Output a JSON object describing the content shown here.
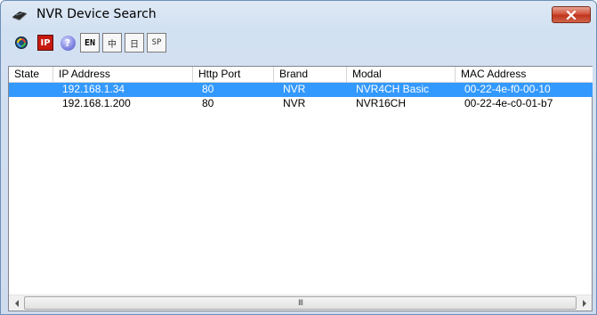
{
  "window": {
    "title": "NVR Device Search",
    "close_icon": "close-icon"
  },
  "toolbar": {
    "buttons": [
      {
        "name": "search-icon",
        "label": ""
      },
      {
        "name": "ip-icon",
        "label": "IP"
      },
      {
        "name": "help-icon",
        "label": "?"
      },
      {
        "name": "lang-en-button",
        "label": "EN"
      },
      {
        "name": "lang-zh-traditional-button",
        "label": "中"
      },
      {
        "name": "lang-zh-simplified-button",
        "label": "日"
      },
      {
        "name": "lang-sp-button",
        "label": "SP"
      }
    ]
  },
  "table": {
    "columns": [
      "State",
      "IP Address",
      "Http Port",
      "Brand",
      "Modal",
      "MAC Address"
    ],
    "rows": [
      {
        "state": "",
        "ip": "192.168.1.34",
        "port": "80",
        "brand": "NVR",
        "modal": "NVR4CH Basic",
        "mac": "00-22-4e-f0-00-10",
        "selected": true
      },
      {
        "state": "",
        "ip": "192.168.1.200",
        "port": "80",
        "brand": "NVR",
        "modal": "NVR16CH",
        "mac": "00-22-4e-c0-01-b7",
        "selected": false
      }
    ]
  },
  "scrollbar": {
    "grip": "III"
  },
  "colors": {
    "selection": "#3399ff",
    "close_button": "#c7402a"
  }
}
